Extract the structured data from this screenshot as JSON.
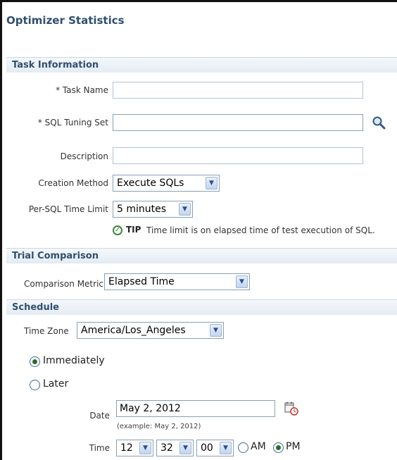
{
  "page": {
    "title": "Optimizer Statistics"
  },
  "task_information": {
    "header": "Task Information",
    "task_name_label": "* Task Name",
    "task_name_value": "",
    "sql_tuning_set_label": "* SQL Tuning Set",
    "sql_tuning_set_value": "",
    "description_label": "Description",
    "description_value": "",
    "creation_method_label": "Creation Method",
    "creation_method_value": "Execute SQLs",
    "time_limit_label": "Per-SQL Time Limit",
    "time_limit_value": "5 minutes",
    "tip_label": "TIP",
    "tip_text": "Time limit is on elapsed time of test execution of SQL."
  },
  "trial_comparison": {
    "header": "Trial Comparison",
    "metric_label": "Comparison Metric",
    "metric_value": "Elapsed Time"
  },
  "schedule": {
    "header": "Schedule",
    "timezone_label": "Time Zone",
    "timezone_value": "America/Los_Angeles",
    "immediately_label": "Immediately",
    "later_label": "Later",
    "date_label": "Date",
    "date_value": "May 2, 2012",
    "date_hint": "(example: May 2, 2012)",
    "time_label": "Time",
    "hour": "12",
    "minute": "32",
    "second": "00",
    "am_label": "AM",
    "pm_label": "PM"
  },
  "icons": {
    "search": "magnifier-icon",
    "calendar": "calendar-icon",
    "tip": "check-circle-icon",
    "dropdown": "chevron-down-icon"
  },
  "colors": {
    "section_text": "#2f4f6f",
    "tip_green": "#3a8a3a"
  }
}
